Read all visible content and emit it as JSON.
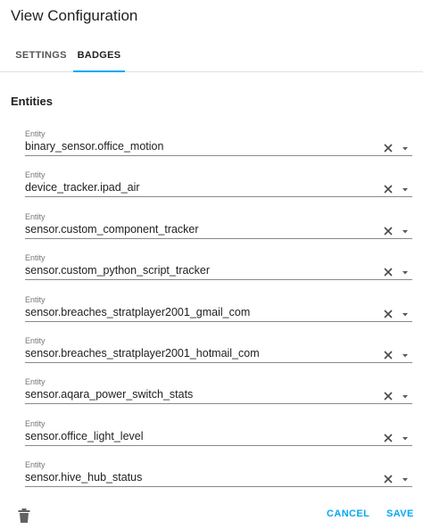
{
  "dialog": {
    "title": "View Configuration"
  },
  "tabs": [
    {
      "label": "SETTINGS",
      "active": false
    },
    {
      "label": "BADGES",
      "active": true
    }
  ],
  "section": {
    "title": "Entities"
  },
  "entities": [
    {
      "label": "Entity",
      "value": "binary_sensor.office_motion"
    },
    {
      "label": "Entity",
      "value": "device_tracker.ipad_air"
    },
    {
      "label": "Entity",
      "value": "sensor.custom_component_tracker"
    },
    {
      "label": "Entity",
      "value": "sensor.custom_python_script_tracker"
    },
    {
      "label": "Entity",
      "value": "sensor.breaches_stratplayer2001_gmail_com"
    },
    {
      "label": "Entity",
      "value": "sensor.breaches_stratplayer2001_hotmail_com"
    },
    {
      "label": "Entity",
      "value": "sensor.aqara_power_switch_stats"
    },
    {
      "label": "Entity",
      "value": "sensor.office_light_level"
    },
    {
      "label": "Entity",
      "value": "sensor.hive_hub_status"
    }
  ],
  "footer": {
    "cancel_label": "CANCEL",
    "save_label": "SAVE"
  },
  "icons": {
    "clear": "close-icon",
    "dropdown": "dropdown-arrow-icon",
    "delete": "trash-icon"
  },
  "colors": {
    "accent": "#03a9f4",
    "text": "#212121",
    "label": "#757575"
  }
}
